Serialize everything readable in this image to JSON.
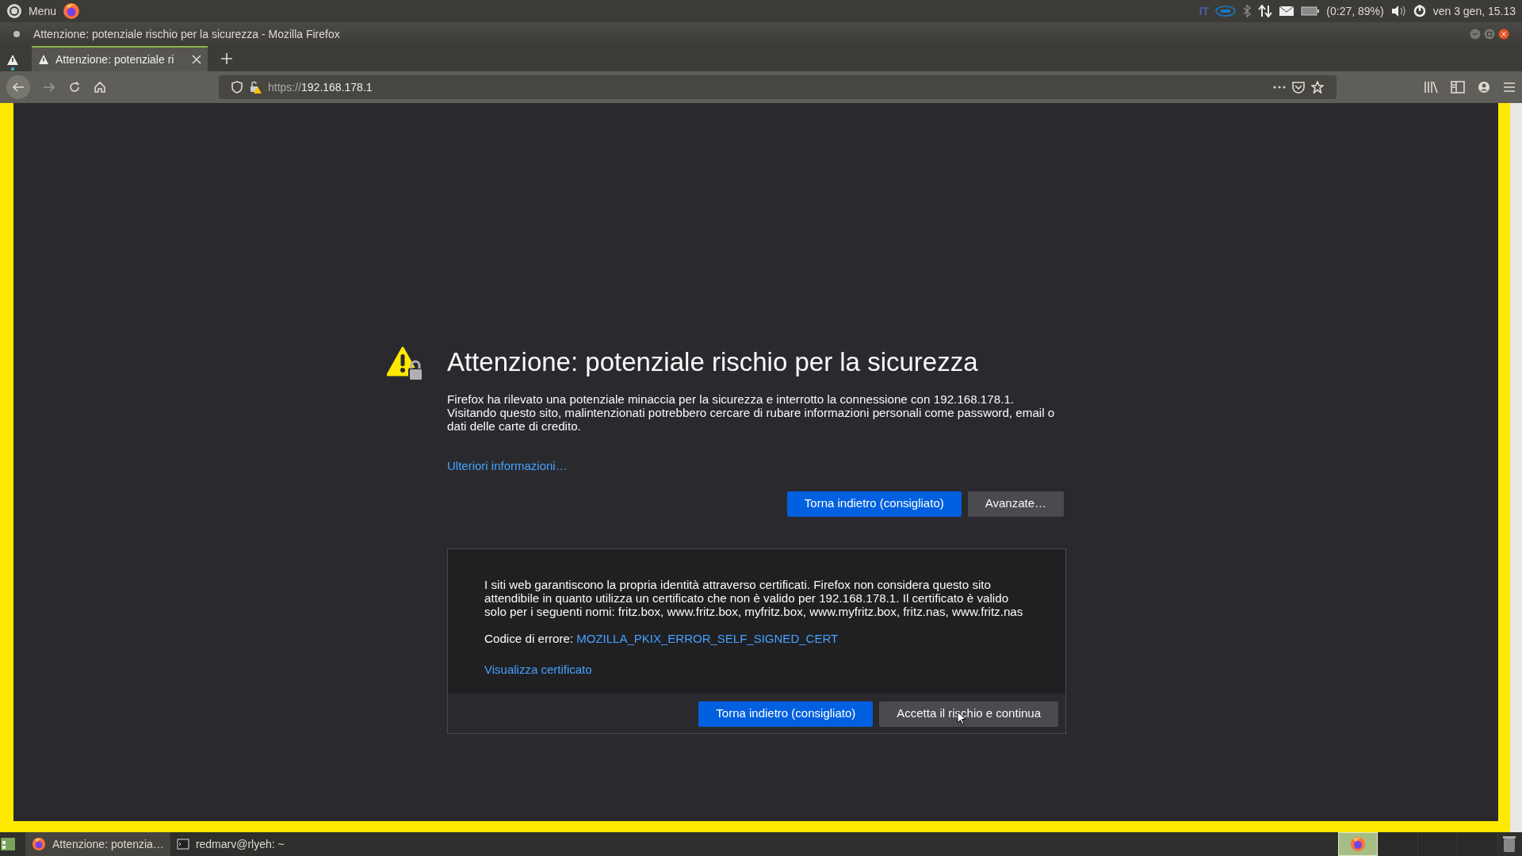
{
  "top_panel": {
    "menu_label": "Menu",
    "keyboard_layout": "IT",
    "battery_reading": "(0:27, 89%)",
    "clock": "ven 3 gen, 15.13"
  },
  "window": {
    "title": "Attenzione: potenziale rischio per la sicurezza - Mozilla Firefox"
  },
  "tabs": [
    {
      "label": "Attenzione: potenziale ri",
      "selected": true
    }
  ],
  "address_bar": {
    "scheme": "https://",
    "host": "192.168.178.1"
  },
  "error_page": {
    "title": "Attenzione: potenziale rischio per la sicurezza",
    "description": "Firefox ha rilevato una potenziale minaccia per la sicurezza e interrotto la connessione con 192.168.178.1. Visitando questo sito, malintenzionati potrebbero cercare di rubare informazioni personali come password, email o dati delle carte di credito.",
    "learn_more_link": "Ulteriori informazioni…",
    "buttons": [
      {
        "label": "Torna indietro (consigliato)",
        "kind": "primary"
      },
      {
        "label": "Avanzate…",
        "kind": "secondary"
      }
    ],
    "advanced_panel": {
      "explanation": "I siti web garantiscono la propria identità attraverso certificati. Firefox non considera questo sito attendibile in quanto utilizza un certificato che non è valido per 192.168.178.1. Il certificato è valido solo per i seguenti nomi: fritz.box, www.fritz.box, myfritz.box, www.myfritz.box, fritz.nas, www.fritz.nas",
      "error_code_label": "Codice di errore:",
      "error_code": "MOZILLA_PKIX_ERROR_SELF_SIGNED_CERT",
      "view_certificate_link": "Visualizza certificato",
      "buttons": [
        {
          "label": "Torna indietro (consigliato)",
          "kind": "primary"
        },
        {
          "label": "Accetta il rischio e continua",
          "kind": "secondary"
        }
      ]
    }
  },
  "taskbar": {
    "windows": [
      {
        "label": "Attenzione: potenzia…",
        "kind": "browser",
        "selected": true
      },
      {
        "label": "redmarv@rlyeh: ~",
        "kind": "terminal",
        "selected": false
      }
    ],
    "workspaces": [
      {
        "selected": true
      },
      {
        "selected": false
      },
      {
        "selected": false
      },
      {
        "selected": false
      }
    ]
  }
}
